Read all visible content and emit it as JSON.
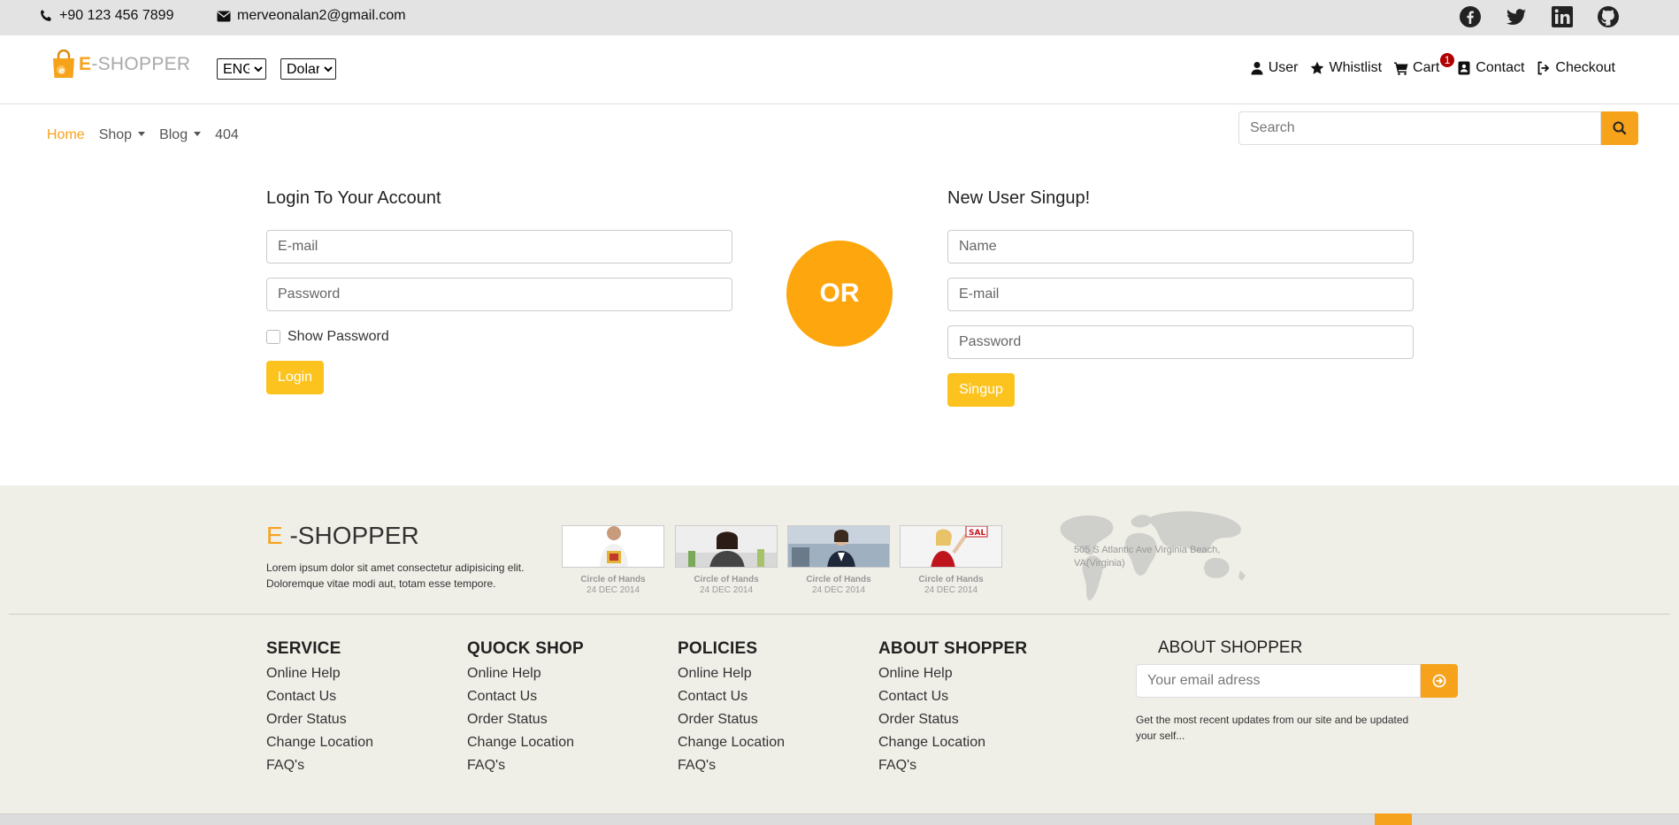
{
  "topbar": {
    "phone": "+90 123 456 7899",
    "email": "merveonalan2@gmail.com",
    "social": [
      "facebook-icon",
      "twitter-icon",
      "linkedin-icon",
      "github-icon"
    ]
  },
  "header": {
    "logo_e": "E",
    "logo_rest": "-SHOPPER",
    "language": "ENG",
    "currency": "Dolar",
    "nav": {
      "user": "User",
      "wishlist": "Whistlist",
      "cart": "Cart",
      "cart_count": "1",
      "contact": "Contact",
      "checkout": "Checkout"
    }
  },
  "menu": {
    "home": "Home",
    "shop": "Shop",
    "blog": "Blog",
    "notfound": "404",
    "search_placeholder": "Search"
  },
  "login": {
    "title": "Login To Your Account",
    "email_placeholder": "E-mail",
    "password_placeholder": "Password",
    "show_password": "Show Password",
    "button": "Login"
  },
  "or_text": "OR",
  "signup": {
    "title": "New User Singup!",
    "name_placeholder": "Name",
    "email_placeholder": "E-mail",
    "password_placeholder": "Password",
    "button": "Singup"
  },
  "footer": {
    "brand_e": "E",
    "brand_rest": " -SHOPPER",
    "text": "Lorem ipsum dolor sit amet consectetur adipisicing elit. Doloremque vitae modi aut, totam esse tempore.",
    "thumbs": [
      {
        "title": "Circle of Hands",
        "date": "24 DEC 2014"
      },
      {
        "title": "Circle of Hands",
        "date": "24 DEC 2014"
      },
      {
        "title": "Circle of Hands",
        "date": "24 DEC 2014"
      },
      {
        "title": "Circle of Hands",
        "date": "24 DEC 2014"
      }
    ],
    "address": "505 S Atlantic Ave Virginia Beach, VA(Virginia)",
    "columns": [
      {
        "title": "SERVICE",
        "links": [
          "Online Help",
          "Contact Us",
          "Order Status",
          "Change Location",
          "FAQ's"
        ]
      },
      {
        "title": "QUOCK SHOP",
        "links": [
          "Online Help",
          "Contact Us",
          "Order Status",
          "Change Location",
          "FAQ's"
        ]
      },
      {
        "title": "POLICIES",
        "links": [
          "Online Help",
          "Contact Us",
          "Order Status",
          "Change Location",
          "FAQ's"
        ]
      },
      {
        "title": "ABOUT SHOPPER",
        "links": [
          "Online Help",
          "Contact Us",
          "Order Status",
          "Change Location",
          "FAQ's"
        ]
      }
    ],
    "about_title": "ABOUT SHOPPER",
    "email_placeholder": "Your email adress",
    "about_text": "Get the most recent updates from our site and be updated your self..."
  },
  "colors": {
    "accent": "#f7a21b",
    "button": "#fcc31f",
    "badge": "#b00000",
    "footer_bg": "#efeee7"
  }
}
